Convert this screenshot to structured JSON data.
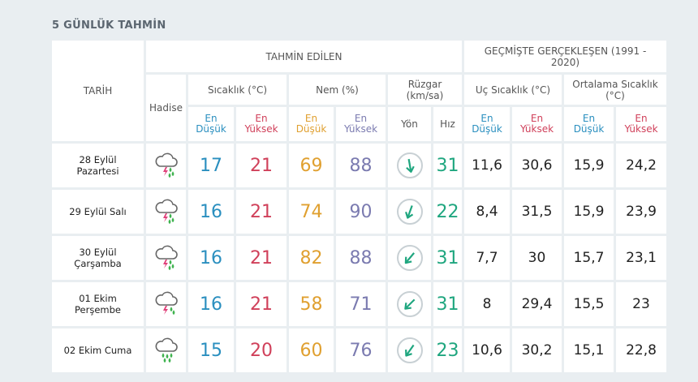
{
  "title": "5 GÜNLÜK TAHMİN",
  "headers": {
    "date": "TARİH",
    "forecast_group": "TAHMİN EDİLEN",
    "history_group": "GEÇMİŞTE GERÇEKLEŞEN (1991 - 2020)",
    "event": "Hadise",
    "temp": "Sıcaklık (°C)",
    "humidity": "Nem (%)",
    "wind": "Rüzgar (km/sa)",
    "extreme_temp": "Uç Sıcaklık (°C)",
    "avg_temp": "Ortalama Sıcaklık (°C)",
    "low": "En Düşük",
    "high": "En Yüksek",
    "direction": "Yön",
    "speed": "Hız"
  },
  "rows": [
    {
      "date": "28 Eylül Pazartesi",
      "icon": "thunderstorm-rain-icon",
      "temp_low": "17",
      "temp_high": "21",
      "hum_low": "69",
      "hum_high": "88",
      "wind_dir_deg": 170,
      "wind_speed": "31",
      "ext_low": "11,6",
      "ext_high": "30,6",
      "avg_low": "15,9",
      "avg_high": "24,2"
    },
    {
      "date": "29 Eylül Salı",
      "icon": "thunderstorm-rain-icon",
      "temp_low": "16",
      "temp_high": "21",
      "hum_low": "74",
      "hum_high": "90",
      "wind_dir_deg": 200,
      "wind_speed": "22",
      "ext_low": "8,4",
      "ext_high": "31,5",
      "avg_low": "15,9",
      "avg_high": "23,9"
    },
    {
      "date": "30 Eylül Çarşamba",
      "icon": "thunderstorm-rain-icon",
      "temp_low": "16",
      "temp_high": "21",
      "hum_low": "82",
      "hum_high": "88",
      "wind_dir_deg": 220,
      "wind_speed": "31",
      "ext_low": "7,7",
      "ext_high": "30",
      "avg_low": "15,7",
      "avg_high": "23,1"
    },
    {
      "date": "01 Ekim Perşembe",
      "icon": "thunderstorm-icon",
      "temp_low": "16",
      "temp_high": "21",
      "hum_low": "58",
      "hum_high": "71",
      "wind_dir_deg": 225,
      "wind_speed": "31",
      "ext_low": "8",
      "ext_high": "29,4",
      "avg_low": "15,5",
      "avg_high": "23"
    },
    {
      "date": "02 Ekim Cuma",
      "icon": "rain-icon",
      "temp_low": "15",
      "temp_high": "20",
      "hum_low": "60",
      "hum_high": "76",
      "wind_dir_deg": 215,
      "wind_speed": "23",
      "ext_low": "10,6",
      "ext_high": "30,2",
      "avg_low": "15,1",
      "avg_high": "22,8"
    }
  ],
  "colors": {
    "low": "#2a8fbf",
    "high": "#d0405a",
    "humidity_low": "#e0a030",
    "humidity_high": "#7b7bb0",
    "wind_speed": "#1fa67f"
  }
}
